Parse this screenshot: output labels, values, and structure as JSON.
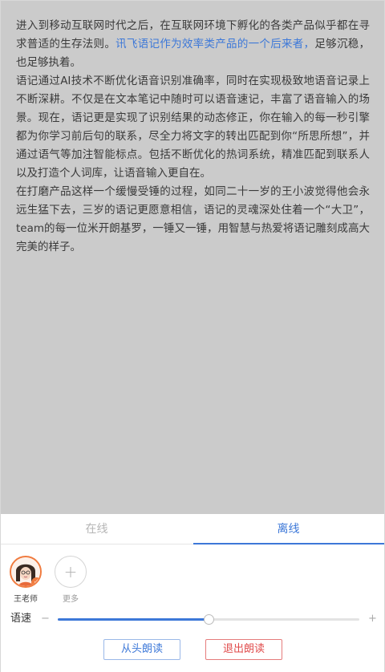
{
  "article": {
    "p1_a": "进入到移动互联网时代之后，在互联网环境下孵化的各类产品似乎都在寻求普适的生存法则。",
    "p1_highlight": "讯飞语记作为效率类产品的一个后来者，",
    "p1_b": "足够沉稳，也足够执着。",
    "p2": "语记通过AI技术不断优化语音识别准确率，同时在实现极致地语音记录上不断深耕。不仅是在文本笔记中随时可以语音速记，丰富了语音输入的场景。现在，语记更是实现了识别结果的动态修正，你在输入的每一秒引擎都为你学习前后句的联系，尽全力将文字的转出匹配到你“所思所想”，并通过语气等加注智能标点。包括不断优化的热词系统，精准匹配到联系人以及打造个人词库，让语音输入更自在。",
    "p3": "在打磨产品这样一个缓慢受锤的过程，如同二十一岁的王小波觉得他会永远生猛下去，三岁的语记更愿意相信，语记的灵魂深处住着一个“大卫”，team的每一位米开朗基罗，一锤又一锤，用智慧与热爱将语记雕刻成高大完美的样子。"
  },
  "tabs": {
    "online": "在线",
    "offline": "离线",
    "active": "offline"
  },
  "voices": {
    "selected": {
      "label": "王老师",
      "icon": "teacher-avatar-icon"
    },
    "more": {
      "label": "更多",
      "glyph": "+"
    }
  },
  "speed": {
    "label": "语速",
    "minus": "−",
    "plus": "+",
    "value": 0.5
  },
  "buttons": {
    "restart": "从头朗读",
    "exit": "退出朗读"
  },
  "colors": {
    "accent": "#3d78d8",
    "danger": "#e04b4b",
    "avatar_ring": "#f07b3f"
  }
}
